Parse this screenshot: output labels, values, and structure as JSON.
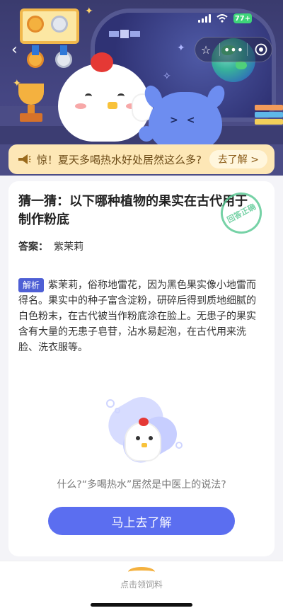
{
  "status_bar": {
    "battery": "77+",
    "colors": {
      "battery": "#3ed57a"
    }
  },
  "nav": {
    "back_icon": "back-chevron-icon",
    "capsule_icons": [
      "star-icon",
      "more-icon",
      "target-icon"
    ]
  },
  "banner": {
    "icon": "megaphone-icon",
    "text": "惊！夏天多喝热水好处居然这么多?",
    "action": "去了解 >"
  },
  "question": {
    "title": "猜一猜：以下哪种植物的果实在古代用于制作粉底",
    "stamp": "回答正确"
  },
  "answer": {
    "label": "答案：",
    "value": "紫茉莉"
  },
  "explanation": {
    "tag": "解析",
    "text": "紫茉莉，俗称地雷花，因为黑色果实像小地雷而得名。果实中的种子富含淀粉，研碎后得到质地细腻的白色粉末，在古代被当作粉底涂在脸上。无患子的果实含有大量的无患子皂苷，沾水易起泡，在古代用来洗脸、洗衣服等。"
  },
  "promo": {
    "hint": "什么?“多喝热水”居然是中医上的说法?",
    "button": "马上去了解"
  },
  "bottom_bar": {
    "label": "点击领饲料"
  },
  "colors": {
    "accent": "#5b6ef0",
    "tag": "#4e5fd5",
    "banner_bg": "#fde7b6",
    "stamp": "#55c791"
  }
}
